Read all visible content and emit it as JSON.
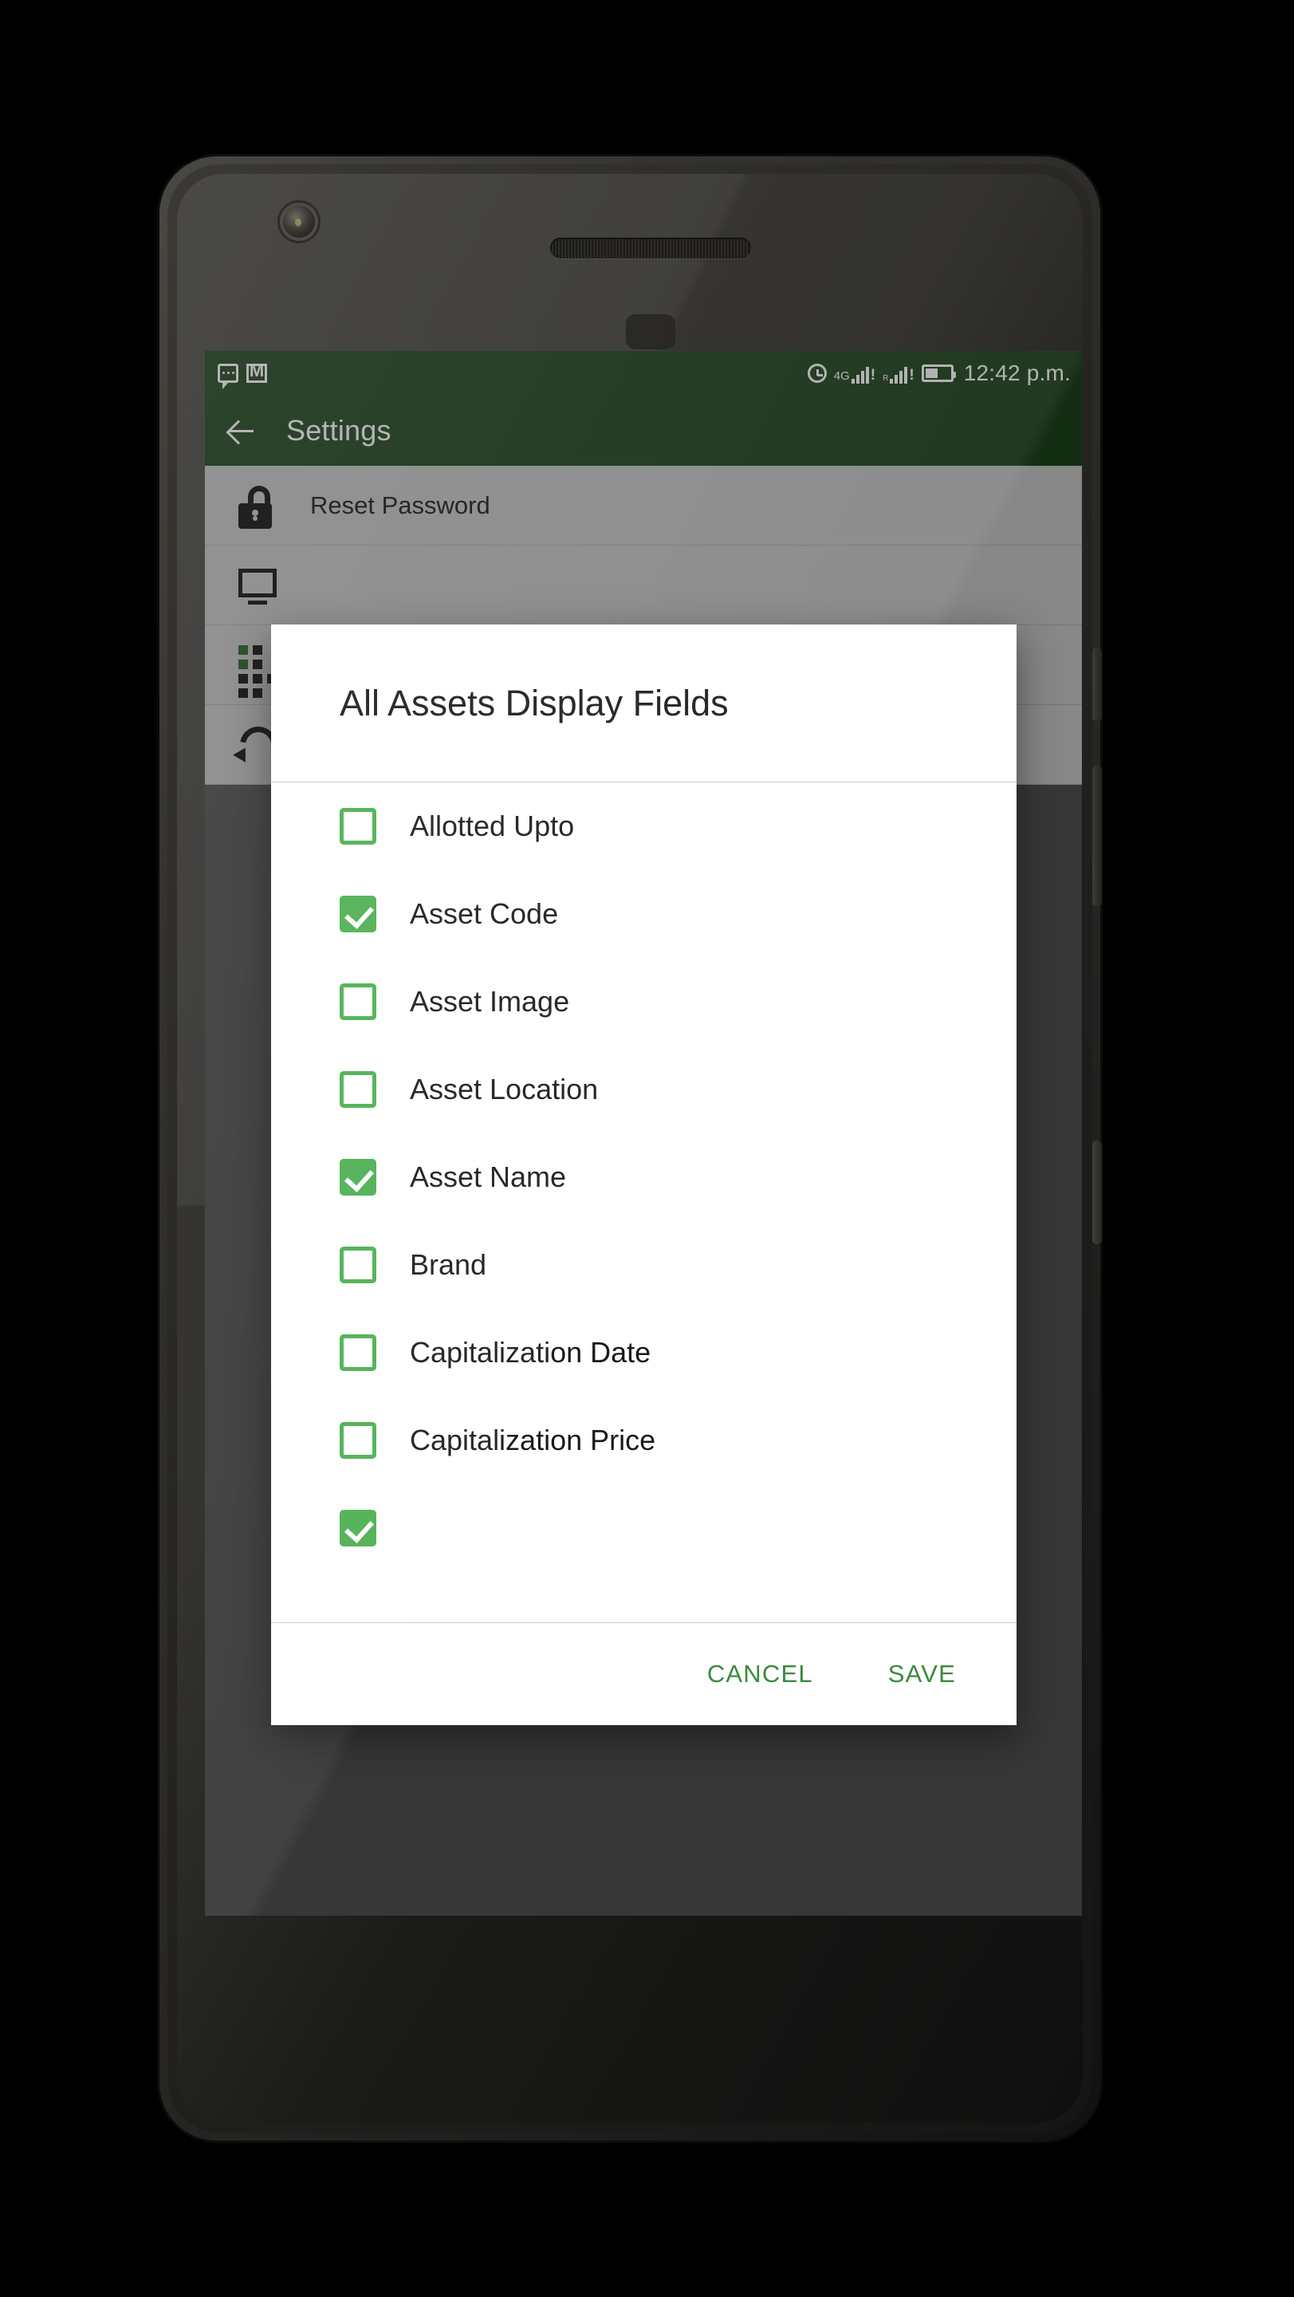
{
  "statusbar": {
    "notifications": [
      {
        "icon": "message-icon"
      },
      {
        "icon": "gmail-icon"
      }
    ],
    "alarm_icon": "alarm-icon",
    "sim1": {
      "network_label": "4G",
      "alert": "!"
    },
    "sim2": {
      "roaming_label": "R",
      "alert": "!"
    },
    "battery_icon": "battery-icon",
    "time": "12:42 p.m."
  },
  "appbar": {
    "back_icon": "back-arrow-icon",
    "title": "Settings"
  },
  "settings": {
    "items": [
      {
        "icon": "unlock-icon",
        "label": "Reset Password"
      },
      {
        "icon": "monitor-icon",
        "label": ""
      },
      {
        "icon": "barcode-grid-icon",
        "label": ""
      },
      {
        "icon": "refresh-icon",
        "label": ""
      }
    ]
  },
  "dialog": {
    "title": "All Assets Display Fields",
    "options": [
      {
        "label": "Allotted Upto",
        "checked": false
      },
      {
        "label": "Asset Code",
        "checked": true
      },
      {
        "label": "Asset Image",
        "checked": false
      },
      {
        "label": "Asset Location",
        "checked": false
      },
      {
        "label": "Asset Name",
        "checked": true
      },
      {
        "label": "Brand",
        "checked": false
      },
      {
        "label": "Capitalization Date",
        "checked": false
      },
      {
        "label": "Capitalization Price",
        "checked": false
      },
      {
        "label": "",
        "checked": true
      }
    ],
    "cancel_label": "CANCEL",
    "save_label": "SAVE"
  },
  "colors": {
    "appbar_green": "#1e441e",
    "accent_green": "#4caf50",
    "action_green": "#3a8a3f",
    "scrim": "#666666"
  }
}
